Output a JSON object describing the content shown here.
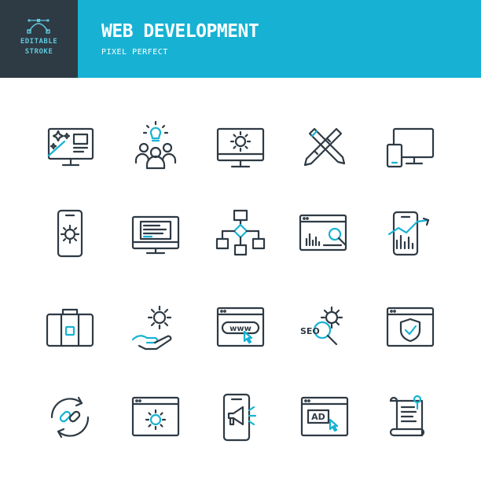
{
  "header": {
    "badge_line1": "EDITABLE",
    "badge_line2": "STROKE",
    "title": "WEB DEVELOPMENT",
    "subtitle": "PIXEL PERFECT"
  },
  "colors": {
    "dark": "#2e3a44",
    "accent": "#17b2d3",
    "background": "#ffffff"
  },
  "icons": [
    "magic-wand-monitor-icon",
    "team-idea-icon",
    "monitor-gear-icon",
    "pencil-ruler-icon",
    "responsive-devices-icon",
    "smartphone-gear-icon",
    "code-monitor-icon",
    "flowchart-icon",
    "browser-analytics-search-icon",
    "smartphone-chart-icon",
    "briefcase-icon",
    "hand-gear-icon",
    "browser-www-icon",
    "seo-search-gear-icon",
    "browser-shield-icon",
    "link-refresh-icon",
    "browser-gear-icon",
    "smartphone-megaphone-icon",
    "browser-ad-icon",
    "script-scroll-icon"
  ],
  "texts": {
    "www": "www",
    "seo": "SEO",
    "ad": "AD"
  }
}
